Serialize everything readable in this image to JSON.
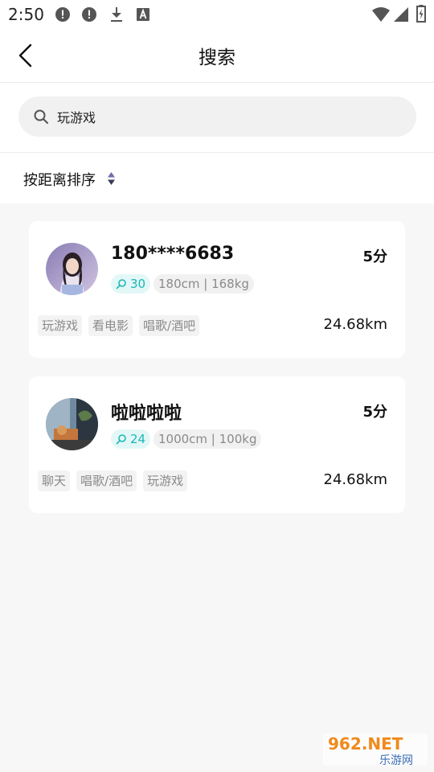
{
  "status_bar": {
    "time": "2:50"
  },
  "header": {
    "title": "搜索"
  },
  "search": {
    "value": "玩游戏"
  },
  "sort": {
    "label": "按距离排序"
  },
  "results": [
    {
      "name": "180****6683",
      "score": "5分",
      "age": "30",
      "height_weight": "180cm | 168kg",
      "tags": [
        "玩游戏",
        "看电影",
        "唱歌/酒吧"
      ],
      "distance": "24.68km"
    },
    {
      "name": "啦啦啦啦",
      "score": "5分",
      "age": "24",
      "height_weight": "1000cm | 100kg",
      "tags": [
        "聊天",
        "唱歌/酒吧",
        "玩游戏"
      ],
      "distance": "24.68km"
    }
  ],
  "watermark": {
    "text_top": "962.NET",
    "text_bottom": "乐游网"
  },
  "colors": {
    "accent": "#1db7b7",
    "badge_bg": "#e3f7f7"
  }
}
